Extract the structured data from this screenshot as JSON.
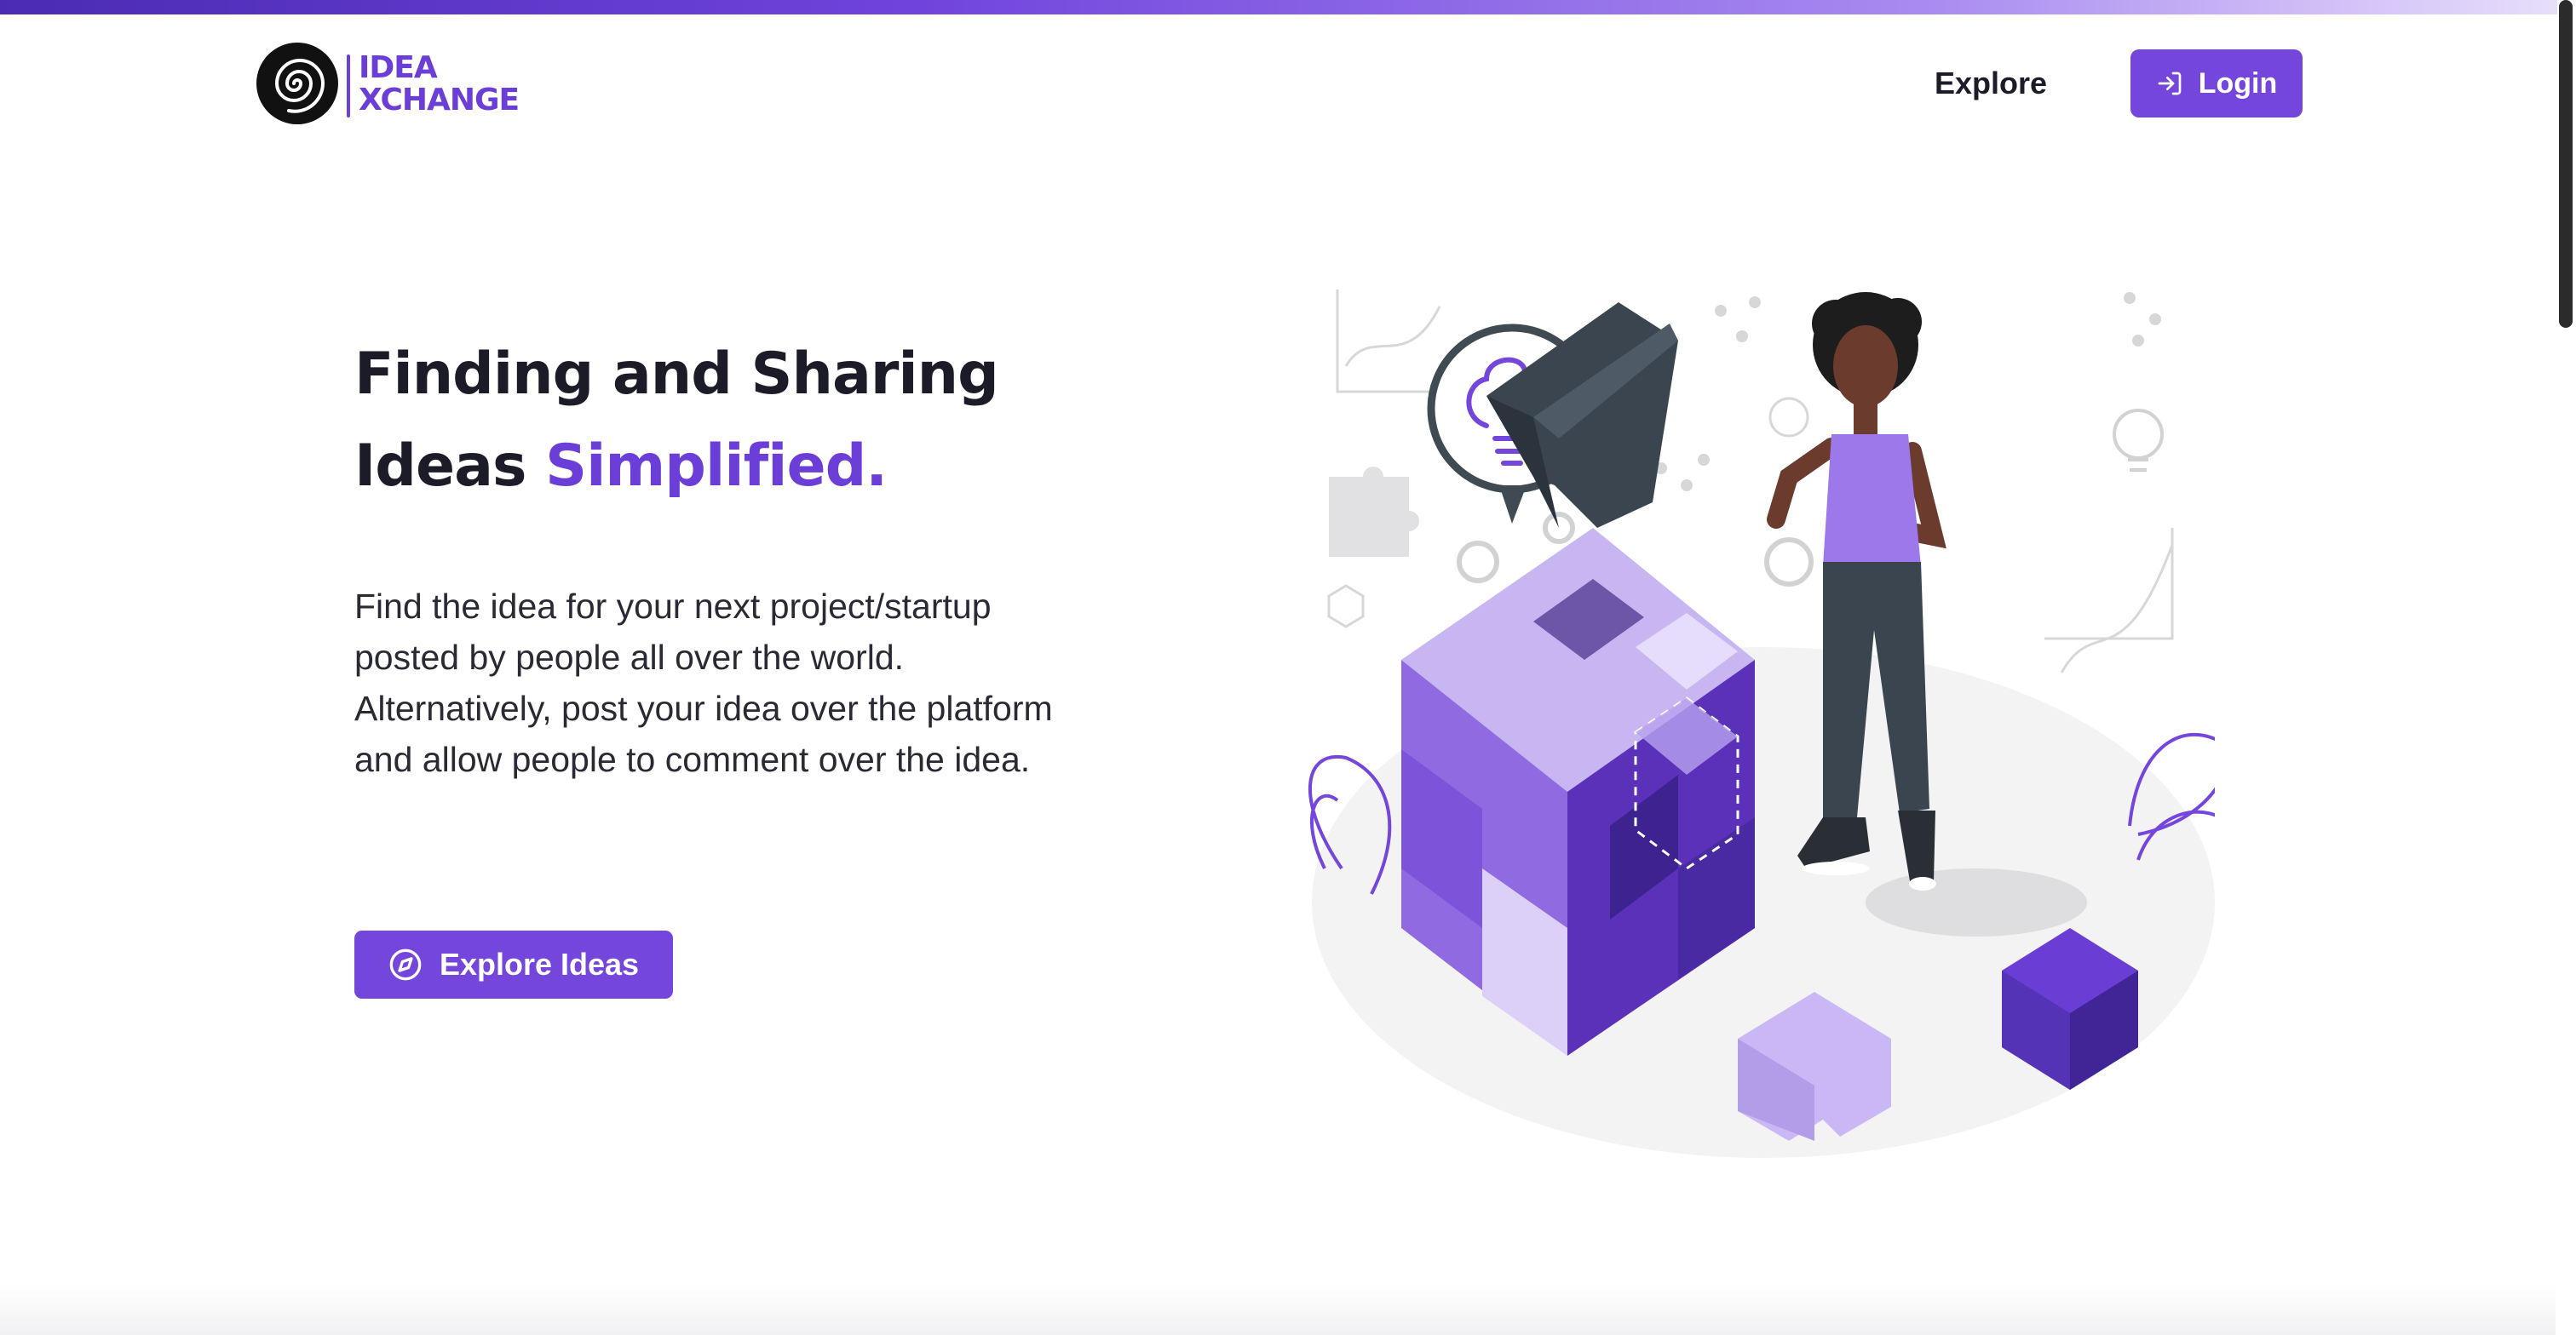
{
  "brand": {
    "line1": "IDEA",
    "line2": "XCHANGE",
    "primary_color": "#7446db",
    "accent_text_color": "#6b3fd7"
  },
  "nav": {
    "explore_label": "Explore",
    "login_label": "Login",
    "login_icon": "login-arrow-icon"
  },
  "hero": {
    "title_line1": "Finding and Sharing",
    "title_line2_plain": "Ideas ",
    "title_line2_accent": "Simplified.",
    "description": "Find the idea for your next project/startup posted by people all over the world. Alternatively, post your idea over the platform and allow people to comment over the idea.",
    "cta_label": "Explore Ideas",
    "cta_icon": "compass-icon"
  },
  "illustration": {
    "name": "puzzle-cube-woman-illustration",
    "bulb_icon": "brain-lightbulb-icon"
  }
}
